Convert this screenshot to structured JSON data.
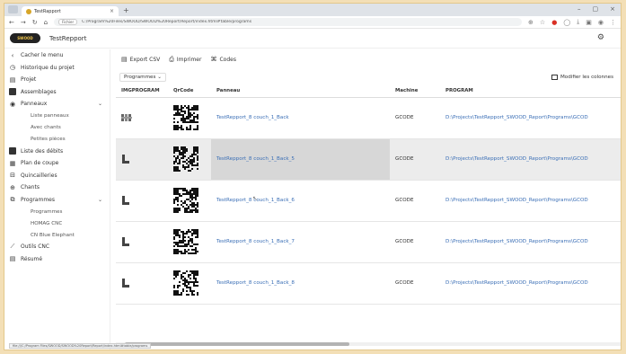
{
  "browser": {
    "tab_title": "TestRapport",
    "tab_close": "×",
    "new_tab": "+",
    "window_controls": [
      "–",
      "▢",
      "×"
    ],
    "url_badge": "Fichier",
    "url": "C:/Program%20Files/SWOOD/SWOOD%20Report/Report/index.html#table/programs",
    "nav_icons": [
      "back-icon",
      "forward-icon",
      "reload-icon",
      "home-icon"
    ]
  },
  "app": {
    "logo_text": "SWOOD",
    "title": "TestRepport"
  },
  "sidebar": {
    "collapse_label": "Cacher le menu",
    "items": [
      {
        "label": "Historique du projet",
        "icon": "history-icon"
      },
      {
        "label": "Projet",
        "icon": "project-icon"
      },
      {
        "label": "Assemblages",
        "icon": "assembly-icon"
      },
      {
        "label": "Panneaux",
        "icon": "panels-icon",
        "expandable": true
      },
      {
        "label": "Liste panneaux",
        "sub": true
      },
      {
        "label": "Avec chants",
        "sub": true
      },
      {
        "label": "Petites pièces",
        "sub": true
      },
      {
        "label": "Liste des débits",
        "icon": "cut-list-icon"
      },
      {
        "label": "Plan de coupe",
        "icon": "cutting-plan-icon"
      },
      {
        "label": "Quincailleries",
        "icon": "hardware-icon"
      },
      {
        "label": "Chants",
        "icon": "edges-icon"
      },
      {
        "label": "Programmes",
        "icon": "programs-icon",
        "expandable": true
      },
      {
        "label": "Programmes",
        "sub": true
      },
      {
        "label": "HOMAG CNC",
        "sub": true
      },
      {
        "label": "CN Blue Elephant",
        "sub": true
      },
      {
        "label": "Outils CNC",
        "icon": "tools-icon"
      },
      {
        "label": "Résumé",
        "icon": "summary-icon"
      }
    ]
  },
  "toolbar": {
    "export_csv": "Export CSV",
    "print": "Imprimer",
    "codes": "Codes"
  },
  "subbar": {
    "select_value": "Programmes",
    "modify_columns": "Modifier les colonnes"
  },
  "table": {
    "columns": [
      "IMGPROGRAM",
      "QrCode",
      "Panneau",
      "Machine",
      "PROGRAM"
    ],
    "rows": [
      {
        "panel": "TestRepport_8 couch_1_Back",
        "machine": "GCODE",
        "program": "D:\\Projects\\TestRepport_SWOOD_Report\\Programs\\GCOD"
      },
      {
        "panel": "TestRepport_8 couch_1_Back_5",
        "machine": "GCODE",
        "program": "D:\\Projects\\TestRepport_SWOOD_Report\\Programs\\GCOD"
      },
      {
        "panel": "TestRepport_8 couch_1_Back_6",
        "machine": "GCODE",
        "program": "D:\\Projects\\TestRepport_SWOOD_Report\\Programs\\GCOD"
      },
      {
        "panel": "TestRepport_8 couch_1_Back_7",
        "machine": "GCODE",
        "program": "D:\\Projects\\TestRepport_SWOOD_Report\\Programs\\GCOD"
      },
      {
        "panel": "TestRepport_8 couch_1_Back_8",
        "machine": "GCODE",
        "program": "D:\\Projects\\TestRepport_SWOOD_Report\\Programs\\GCOD"
      }
    ]
  },
  "statusbar": "file:///C:/Program Files/SWOOD/SWOOD%20Report/Report/index.html#table/programs",
  "colors": {
    "link": "#3b6fb6",
    "highlight_row": "#ececec",
    "frame_border": "#e3c88c"
  }
}
